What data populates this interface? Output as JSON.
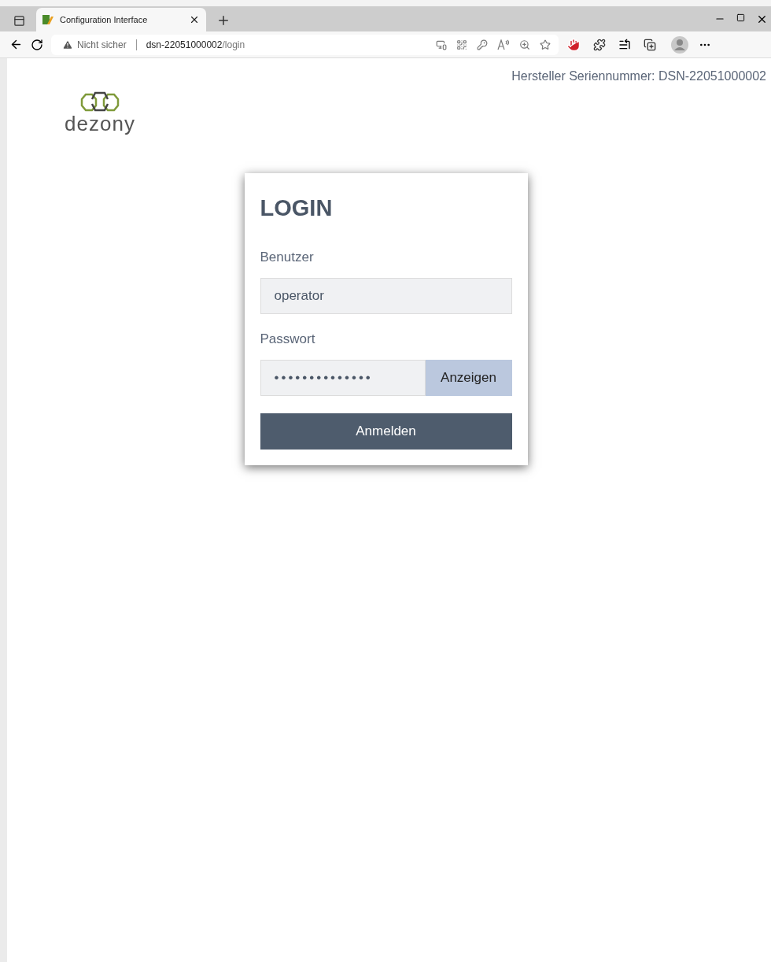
{
  "browser": {
    "tab": {
      "title": "Configuration Interface",
      "selected": true
    },
    "address": {
      "warning": "Nicht sicher",
      "host": "dsn-22051000002",
      "path": "/login"
    }
  },
  "header": {
    "serial": "Hersteller Seriennummer: DSN-22051000002"
  },
  "logo": {
    "text": "dezony"
  },
  "login": {
    "title": "LOGIN",
    "fields": [
      {
        "kind": "text",
        "label": "Benutzer",
        "value": "operator"
      },
      {
        "kind": "password",
        "label": "Passwort",
        "value": "••••••••••••••",
        "toggle": "Anzeigen"
      }
    ],
    "submit": "Anmelden"
  }
}
